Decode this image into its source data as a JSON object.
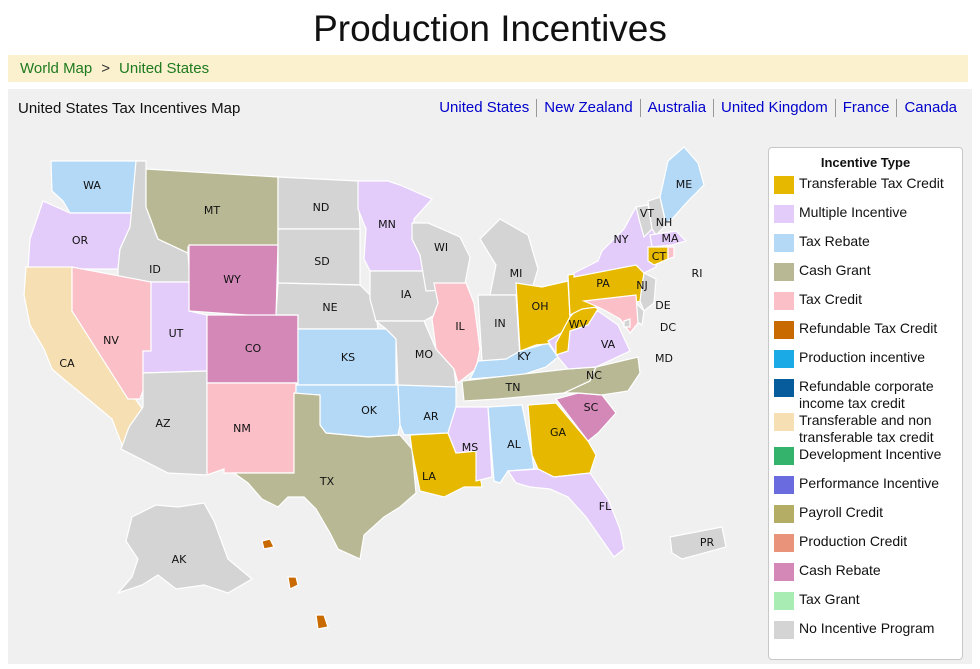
{
  "page": {
    "title": "Production Incentives"
  },
  "breadcrumb": {
    "items": [
      "World Map",
      "United States"
    ],
    "separator": ">"
  },
  "panel": {
    "title": "United States Tax Incentives Map",
    "country_links": [
      "United States",
      "New Zealand",
      "Australia",
      "United Kingdom",
      "France",
      "Canada"
    ]
  },
  "legend": {
    "title": "Incentive Type",
    "items": [
      {
        "label": "Transferable Tax Credit",
        "color": "#e6b800"
      },
      {
        "label": "Multiple Incentive",
        "color": "#e3ccfa"
      },
      {
        "label": "Tax Rebate",
        "color": "#b3d9f7"
      },
      {
        "label": "Cash Grant",
        "color": "#b8b994"
      },
      {
        "label": "Tax Credit",
        "color": "#fbbfc8"
      },
      {
        "label": "Refundable Tax Credit",
        "color": "#c96a00"
      },
      {
        "label": "Production incentive",
        "color": "#1aaae6"
      },
      {
        "label": "Refundable corporate income tax credit",
        "color": "#075c9c"
      },
      {
        "label": "Transferable and non transferable tax credit",
        "color": "#f5dfb3"
      },
      {
        "label": "Development Incentive",
        "color": "#33b36b"
      },
      {
        "label": "Performance Incentive",
        "color": "#6b6be0"
      },
      {
        "label": "Payroll Credit",
        "color": "#b3ad66"
      },
      {
        "label": "Production Credit",
        "color": "#e8937a"
      },
      {
        "label": "Cash Rebate",
        "color": "#d488b8"
      },
      {
        "label": "Tax Grant",
        "color": "#a8ebb3"
      },
      {
        "label": "No Incentive Program",
        "color": "#d4d4d4"
      }
    ]
  },
  "map": {
    "states": [
      {
        "code": "WA",
        "type": "Tax Rebate"
      },
      {
        "code": "OR",
        "type": "Multiple Incentive"
      },
      {
        "code": "CA",
        "type": "Transferable and non transferable tax credit"
      },
      {
        "code": "ID",
        "type": "No Incentive Program"
      },
      {
        "code": "NV",
        "type": "Tax Credit"
      },
      {
        "code": "MT",
        "type": "Cash Grant"
      },
      {
        "code": "WY",
        "type": "Cash Rebate"
      },
      {
        "code": "UT",
        "type": "Multiple Incentive"
      },
      {
        "code": "AZ",
        "type": "No Incentive Program"
      },
      {
        "code": "CO",
        "type": "Cash Rebate"
      },
      {
        "code": "NM",
        "type": "Tax Credit"
      },
      {
        "code": "ND",
        "type": "No Incentive Program"
      },
      {
        "code": "SD",
        "type": "No Incentive Program"
      },
      {
        "code": "NE",
        "type": "No Incentive Program"
      },
      {
        "code": "KS",
        "type": "Tax Rebate"
      },
      {
        "code": "OK",
        "type": "Tax Rebate"
      },
      {
        "code": "TX",
        "type": "Cash Grant"
      },
      {
        "code": "MN",
        "type": "Multiple Incentive"
      },
      {
        "code": "IA",
        "type": "No Incentive Program"
      },
      {
        "code": "MO",
        "type": "No Incentive Program"
      },
      {
        "code": "AR",
        "type": "Tax Rebate"
      },
      {
        "code": "LA",
        "type": "Transferable Tax Credit"
      },
      {
        "code": "WI",
        "type": "No Incentive Program"
      },
      {
        "code": "IL",
        "type": "Tax Credit"
      },
      {
        "code": "MS",
        "type": "Multiple Incentive"
      },
      {
        "code": "MI",
        "type": "No Incentive Program"
      },
      {
        "code": "IN",
        "type": "No Incentive Program"
      },
      {
        "code": "KY",
        "type": "Tax Rebate"
      },
      {
        "code": "TN",
        "type": "Cash Grant"
      },
      {
        "code": "AL",
        "type": "Tax Rebate"
      },
      {
        "code": "OH",
        "type": "Transferable Tax Credit"
      },
      {
        "code": "GA",
        "type": "Transferable Tax Credit"
      },
      {
        "code": "FL",
        "type": "Multiple Incentive"
      },
      {
        "code": "SC",
        "type": "Cash Rebate"
      },
      {
        "code": "NC",
        "type": "Cash Grant"
      },
      {
        "code": "VA",
        "type": "Multiple Incentive"
      },
      {
        "code": "WV",
        "type": "Transferable Tax Credit"
      },
      {
        "code": "PA",
        "type": "Transferable Tax Credit"
      },
      {
        "code": "NY",
        "type": "Multiple Incentive"
      },
      {
        "code": "VT",
        "type": "No Incentive Program"
      },
      {
        "code": "NH",
        "type": "No Incentive Program"
      },
      {
        "code": "ME",
        "type": "Tax Rebate"
      },
      {
        "code": "MA",
        "type": "Multiple Incentive"
      },
      {
        "code": "CT",
        "type": "Transferable Tax Credit"
      },
      {
        "code": "RI",
        "type": "Tax Credit"
      },
      {
        "code": "NJ",
        "type": "No Incentive Program"
      },
      {
        "code": "DE",
        "type": "No Incentive Program"
      },
      {
        "code": "MD",
        "type": "Tax Credit"
      },
      {
        "code": "DC",
        "type": "No Incentive Program"
      },
      {
        "code": "AK",
        "type": "No Incentive Program"
      },
      {
        "code": "HI",
        "type": "Refundable Tax Credit"
      },
      {
        "code": "PR",
        "type": "No Incentive Program"
      }
    ]
  }
}
